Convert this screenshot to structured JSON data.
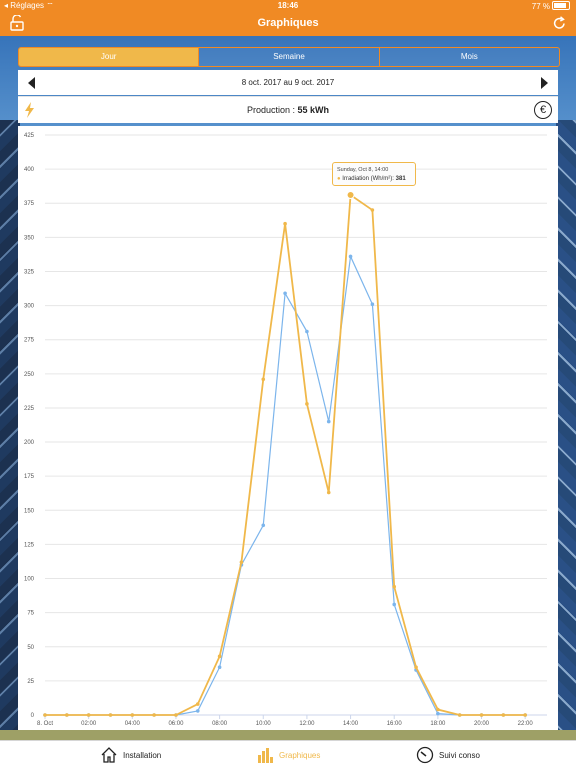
{
  "status_bar": {
    "carrier": "Réglages",
    "time": "18:46",
    "battery": "77 %"
  },
  "nav": {
    "title": "Graphiques"
  },
  "segments": [
    {
      "label": "Jour",
      "active": true
    },
    {
      "label": "Semaine",
      "active": false
    },
    {
      "label": "Mois",
      "active": false
    }
  ],
  "date_range": "8 oct. 2017 au 9 oct. 2017",
  "production": {
    "label": "Production : ",
    "value": "55 kWh"
  },
  "euro_symbol": "€",
  "tooltip": {
    "title": "Sunday, Oct 8, 14:00",
    "series": "Irradiation (Wh/m²): ",
    "value": "381"
  },
  "tabs": [
    {
      "label": "Installation",
      "icon": "home-icon",
      "active": false
    },
    {
      "label": "Graphiques",
      "icon": "bar-chart-icon",
      "active": true
    },
    {
      "label": "Suivi conso",
      "icon": "gauge-icon",
      "active": false
    }
  ],
  "colors": {
    "accent": "#f08a24",
    "series_orange": "#f0b84a",
    "series_blue": "#7cb5ec"
  },
  "chart_data": {
    "type": "line",
    "ylim": [
      0,
      425
    ],
    "y_ticks": [
      0,
      25,
      50,
      75,
      100,
      125,
      150,
      175,
      200,
      225,
      250,
      275,
      300,
      325,
      350,
      375,
      400,
      425
    ],
    "x_ticks": [
      "8. Oct",
      "02:00",
      "04:00",
      "06:00",
      "08:00",
      "10:00",
      "12:00",
      "14:00",
      "16:00",
      "18:00",
      "20:00",
      "22:00"
    ],
    "x_hours": [
      0,
      1,
      2,
      3,
      4,
      5,
      6,
      7,
      8,
      9,
      10,
      11,
      12,
      13,
      14,
      15,
      16,
      17,
      18,
      19,
      20,
      21,
      22
    ],
    "series": [
      {
        "name": "Irradiation (Wh/m²)",
        "color": "#f0b84a",
        "values": [
          0,
          0,
          0,
          0,
          0,
          0,
          0,
          8,
          43,
          112,
          246,
          360,
          228,
          163,
          381,
          370,
          94,
          35,
          4,
          0,
          0,
          0,
          0
        ]
      },
      {
        "color": "#7cb5ec",
        "values": [
          0,
          0,
          0,
          0,
          0,
          0,
          0,
          3,
          35,
          110,
          139,
          309,
          281,
          215,
          336,
          301,
          81,
          33,
          1,
          0,
          0,
          0,
          0
        ]
      }
    ]
  }
}
